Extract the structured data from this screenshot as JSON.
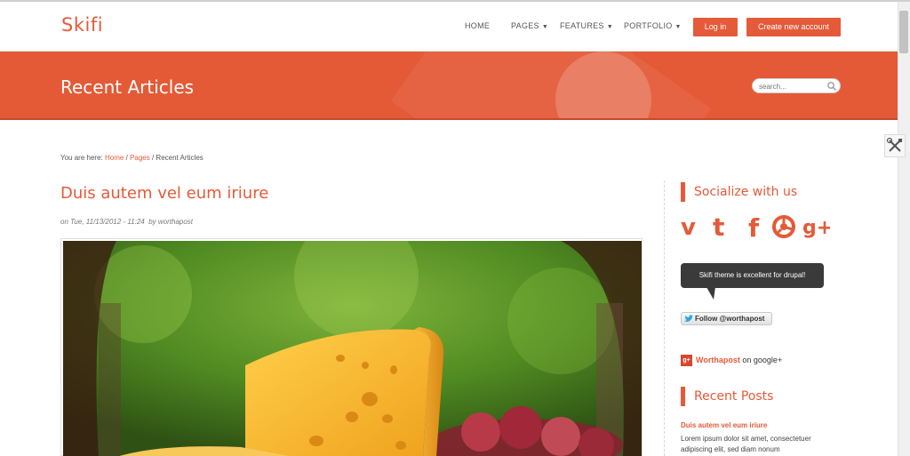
{
  "site": {
    "logo": "Skifi"
  },
  "nav": {
    "items": [
      {
        "label": "HOME",
        "has_dropdown": false
      },
      {
        "label": "PAGES",
        "has_dropdown": true
      },
      {
        "label": "FEATURES",
        "has_dropdown": true
      },
      {
        "label": "PORTFOLIO",
        "has_dropdown": true
      }
    ],
    "login_label": "Log in",
    "create_account_label": "Create new account"
  },
  "banner": {
    "title": "Recent Articles",
    "search_placeholder": "search..."
  },
  "breadcrumb": {
    "prefix": "You are here:",
    "home": "Home",
    "pages": "Pages",
    "current": "Recent Articles",
    "separator": "/"
  },
  "article": {
    "title": "Duis autem vel eum iriure",
    "meta_date": "on Tue, 11/13/2012 - 11:24",
    "meta_author": "by worthapost"
  },
  "sidebar": {
    "socialize_title": "Socialize with us",
    "social_icons": [
      "vimeo-icon",
      "twitter-icon",
      "facebook-icon",
      "picasa-icon",
      "google-plus-icon"
    ],
    "tweet_text": "Skifi theme is excellent for drupal!",
    "follow_label": "Follow @worthapost",
    "gplus_name": "Worthapost",
    "gplus_suffix": "on google+",
    "recent_posts_title": "Recent Posts",
    "recent_post_title": "Duis autem vel eum iriure",
    "recent_post_excerpt": "Lorem ipsum dolor sit amet, consectetuer adipiscing elit, sed diam nonum"
  },
  "colors": {
    "accent": "#e55a38",
    "banner": "#e45a37",
    "tweet_bg": "#3a3a3a"
  }
}
